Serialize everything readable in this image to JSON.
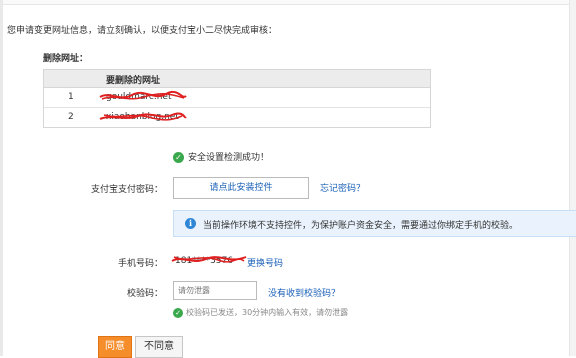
{
  "intro_text": "您申请变更网址信息，请立刻确认，以便支付宝小二尽快完成审核：",
  "section_title": "删除网址：",
  "table": {
    "header": "要删除的网址",
    "rows": [
      {
        "index": "1",
        "url": "gouldmarc.net"
      },
      {
        "index": "2",
        "url": "xiaohanblog.net"
      }
    ]
  },
  "success_message": "安全设置检测成功！",
  "form": {
    "password_label": "支付宝支付密码：",
    "password_control_text": "请点此安装控件",
    "forgot_password_link": "忘记密码？",
    "notice_text": "当前操作环境不支持控件，为保护账户资金安全，需要通过你绑定手机的校验。",
    "phone_label": "手机号码：",
    "phone_value": "181****3576",
    "change_phone_link": "更换号码",
    "code_label": "校验码：",
    "code_placeholder": "请勿泄露",
    "no_code_link": "没有收到校验码？",
    "code_hint": "校验码已发送，30分钟内输入有效，请勿泄露"
  },
  "buttons": {
    "agree": "同意",
    "disagree": "不同意"
  },
  "colors": {
    "link": "#1a60b8",
    "success": "#3aa84c",
    "primary_button": "#f58d2b",
    "notice_bg": "#eaf3fd",
    "redaction": "#e02020"
  },
  "icons": {
    "success": "check-circle-icon",
    "info": "info-circle-icon"
  }
}
